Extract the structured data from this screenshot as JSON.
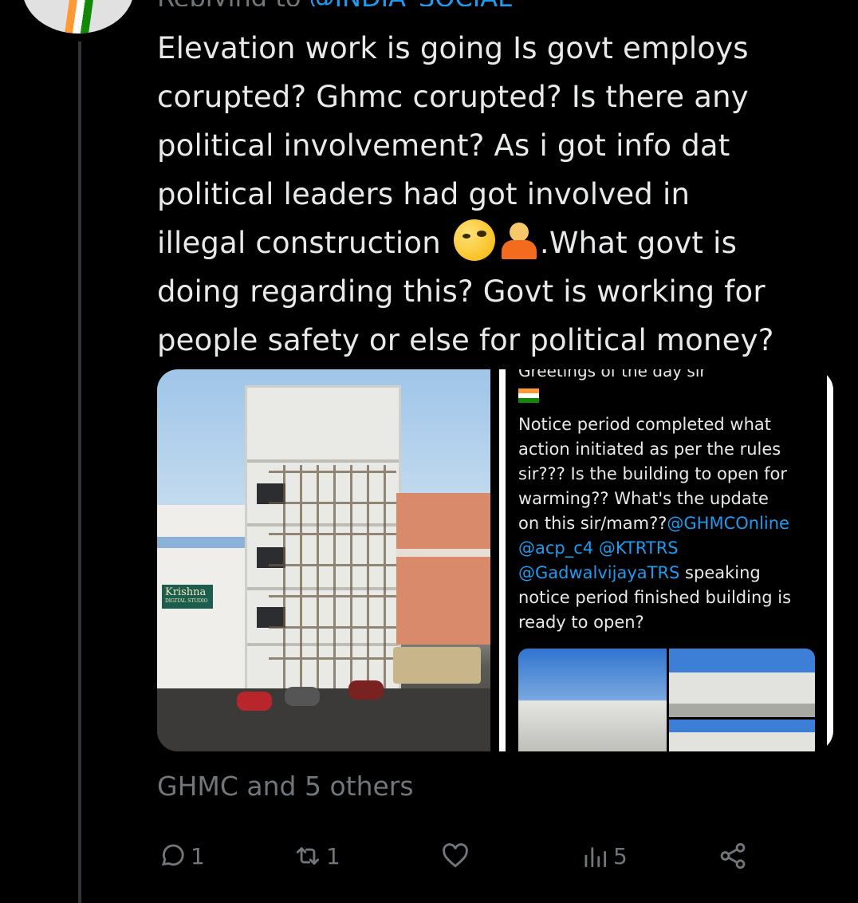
{
  "reply_context": {
    "label": "Replying to",
    "handle": "@INDIA_SOCIAL"
  },
  "tweet": {
    "text_part1": "Elevation work is going Is govt employs\ncorupted? Ghmc corupted? Is there any\npolitical involvement? As i got info dat\npolitical leaders had got involved in\nillegal construction ",
    "emoji_1": "face-with-raised-eyebrow",
    "emoji_2": "person-shrugging",
    "text_part2": ".What govt is\ndoing regarding this? Govt is working for\npeople safety or else for political money?"
  },
  "media": {
    "left_photo": {
      "sign_text": "Krishna",
      "sign_subtext": "DIGITAL STUDIO"
    },
    "right_screenshot": {
      "greeting": "Greetings of the day sir",
      "text_a": "Notice period completed what\naction initiated as per the rules\nsir??? Is the building to open for\nwarming?? What's the update\non this sir/mam??",
      "mention_1": "@GHMCOnline",
      "mention_2": "@acp_c4",
      "mention_3": "@KTRTRS",
      "mention_4": "@GadwalvijayaTRS",
      "text_b": " speaking\nnotice period finished building is\nready to open?"
    }
  },
  "liked_by": "GHMC and 5 others",
  "actions": {
    "reply_count": "1",
    "retweet_count": "1",
    "like_count": "",
    "views_count": "5"
  },
  "colors": {
    "background": "#000000",
    "text": "#e7e9ea",
    "muted": "#71767b",
    "link": "#1d9bf0"
  }
}
